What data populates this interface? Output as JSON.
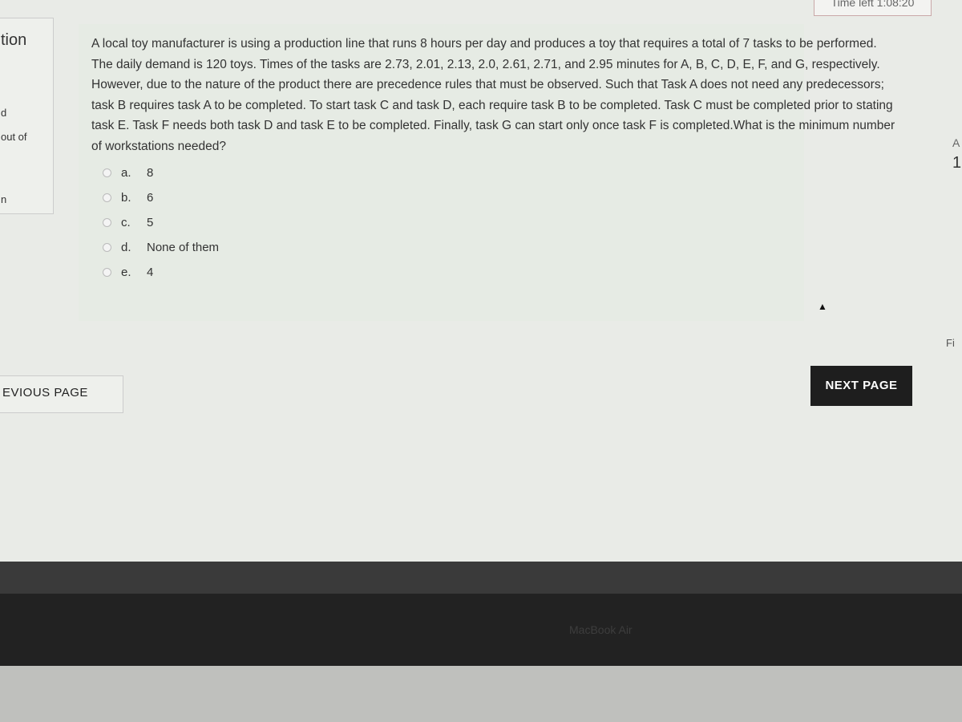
{
  "timer": "Time left 1:08:20",
  "sidebar": {
    "title": "tion",
    "d": "d",
    "out_of": "out of",
    "n": "n"
  },
  "question": {
    "text": "A local toy manufacturer is using a production line that runs 8 hours per day and produces a toy that requires a total of 7 tasks to be performed. The daily demand is 120 toys. Times of the tasks are 2.73, 2.01, 2.13, 2.0, 2.61, 2.71, and 2.95 minutes for A, B, C, D, E, F, and G, respectively. However, due to the nature of the product there are precedence rules that must be observed. Such that Task A does not need any predecessors; task B requires task A to be completed. To start task C and task D, each require task B to be completed. Task C must be completed prior to stating task E. Task F needs both task D and task E to be completed. Finally, task G can start only once task F is completed.What is the minimum number of workstations needed?",
    "options": [
      {
        "letter": "a.",
        "text": "8"
      },
      {
        "letter": "b.",
        "text": "6"
      },
      {
        "letter": "c.",
        "text": "5"
      },
      {
        "letter": "d.",
        "text": "None of them"
      },
      {
        "letter": "e.",
        "text": "4"
      }
    ]
  },
  "nav": {
    "prev": "EVIOUS PAGE",
    "next": "NEXT PAGE"
  },
  "right": {
    "a": "A",
    "one": "1",
    "fi": "Fi"
  },
  "device_label": "MacBook Air"
}
